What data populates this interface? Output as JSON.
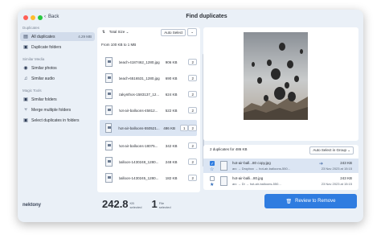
{
  "window": {
    "title": "Find duplicates",
    "back_label": "Back"
  },
  "sidebar": {
    "duplicates_section": "Duplicates",
    "all_duplicates": {
      "label": "All duplicates",
      "size": "4.29 MB"
    },
    "duplicate_folders": "Duplicate folders",
    "similar_media_section": "Similar Media",
    "similar_photos": "Similar photos",
    "similar_audio": "Similar audio",
    "magic_tools_section": "Magic Tools",
    "similar_folders": "Similar folders",
    "merge_folders": "Merge multiple folders",
    "select_duplicates": "Select duplicates in folders",
    "logo": "nektony"
  },
  "list": {
    "sort_label": "Total Size",
    "auto_select": "Auto Select",
    "group_label": "From 100 KB to 1 MB",
    "rows": [
      {
        "name": "beach-4187462_1280.jpg",
        "size": "906 KB",
        "count": "2"
      },
      {
        "name": "beach-6516531_1280.jpg",
        "size": "690 KB",
        "count": "2"
      },
      {
        "name": "zakynthos-1583137_12...",
        "size": "624 KB",
        "count": "2"
      },
      {
        "name": "hot-air-balloons-45812...",
        "size": "522 KB",
        "count": "2"
      },
      {
        "name": "hot-air-balloons-550521...",
        "size": "486 KB",
        "count": "1",
        "count2": "2"
      },
      {
        "name": "hot-air-balloons-18075...",
        "size": "342 KB",
        "count": "2"
      },
      {
        "name": "balloon-1430248_1280...",
        "size": "248 KB",
        "count": "2"
      },
      {
        "name": "balloon-1430245_1280...",
        "size": "182 KB",
        "count": "2"
      }
    ]
  },
  "duplicates": {
    "header": "2 duplicates for 486 KB",
    "auto_select_group": "Auto Select in Group",
    "items": [
      {
        "name": "hot-air-ball...80 copy.jpg",
        "path": "arc → Dropbox → hot-air-balloons-550...",
        "size": "243 KB",
        "date": "23 Nov 2023 at 15:15",
        "checked": true
      },
      {
        "name": "hot-air-balli...80.jpg",
        "path": "arc → Di → hot-air-balloons-550...",
        "size": "243 KB",
        "date": "23 Nov 2023 at 15:15",
        "checked": false
      }
    ]
  },
  "footer": {
    "selected_size": "242.8",
    "size_unit": "KB",
    "size_caption": "selected",
    "selected_files": "1",
    "files_unit": "File",
    "files_caption": "selected",
    "review_button": "Review to Remove"
  },
  "colors": {
    "accent": "#2f7ce0",
    "selected_row": "#dbe5f3",
    "sidebar": "#eaf0f7"
  }
}
